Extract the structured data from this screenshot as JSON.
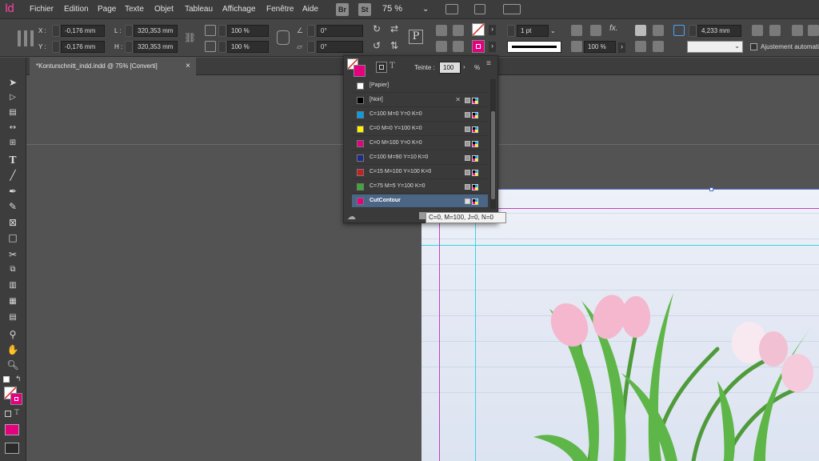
{
  "app": {
    "logo": "Id"
  },
  "menu": [
    "Fichier",
    "Edition",
    "Page",
    "Texte",
    "Objet",
    "Tableau",
    "Affichage",
    "Fenêtre",
    "Aide"
  ],
  "app_buttons": {
    "bridge": "Br",
    "stock": "St"
  },
  "zoom": "75 %",
  "control": {
    "x_label": "X :",
    "x_value": "-0,176 mm",
    "y_label": "Y :",
    "y_value": "-0,176 mm",
    "w_label": "L :",
    "w_value": "320,353 mm",
    "h_label": "H :",
    "h_value": "320,353 mm",
    "scale_x": "100 %",
    "scale_y": "100 %",
    "rotate": "0°",
    "shear": "0°",
    "stroke_weight": "1 pt",
    "opacity": "100 %",
    "offset": "4,233 mm",
    "auto_fit_label": "Ajustement automatique"
  },
  "document_tab": {
    "title": "*Konturschnitt_indd.indd @ 75% [Converti]",
    "close": "×"
  },
  "swatches_panel": {
    "tint_label": "Teinte :",
    "tint_value": "100",
    "tint_unit": "%",
    "swatches": [
      {
        "name": "[Papier]",
        "color": "#ffffff"
      },
      {
        "name": "[Noir]",
        "color": "#000000"
      },
      {
        "name": "C=100 M=0 Y=0 K=0",
        "color": "#00a0e9"
      },
      {
        "name": "C=0 M=0 Y=100 K=0",
        "color": "#fff100"
      },
      {
        "name": "C=0 M=100 Y=0 K=0",
        "color": "#e4007f"
      },
      {
        "name": "C=100 M=90 Y=10 K=0",
        "color": "#1d2a87"
      },
      {
        "name": "C=15 M=100 Y=100 K=0",
        "color": "#c81e1e"
      },
      {
        "name": "C=75 M=5 Y=100 K=0",
        "color": "#3aa935"
      },
      {
        "name": "CutContour",
        "color": "#e4007f"
      }
    ]
  },
  "tooltip": "C=0, M=100, J=0, N=0",
  "colors": {
    "accent": "#e4007f",
    "selection": "#4b6584",
    "guide_cyan": "#33d6e6",
    "guide_magenta": "#c040c0"
  }
}
